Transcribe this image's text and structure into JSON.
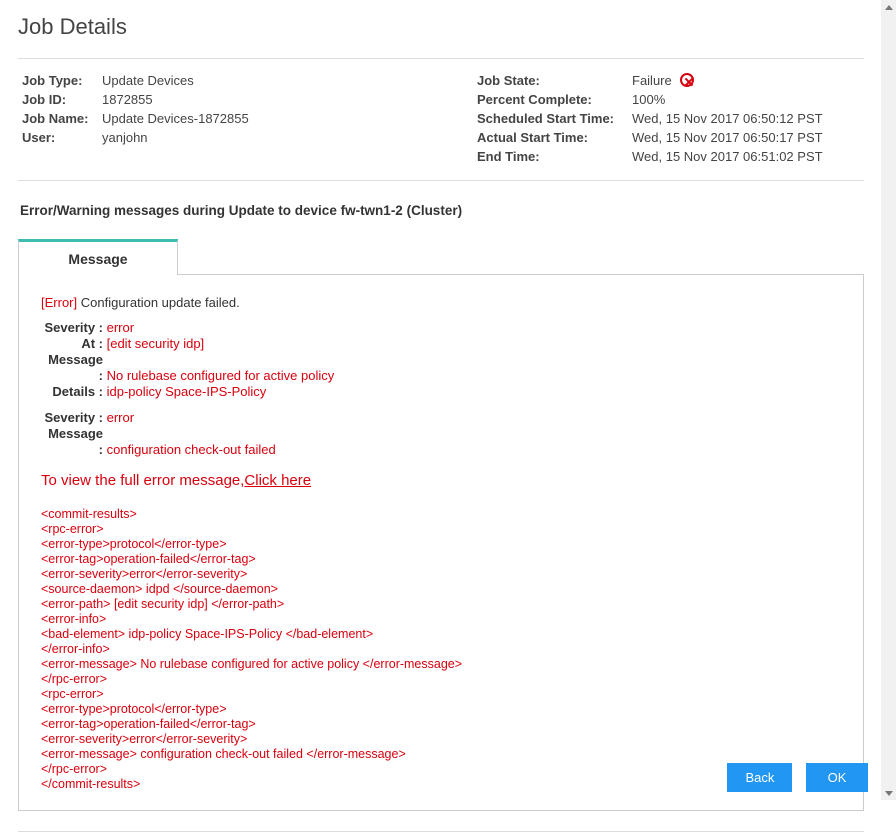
{
  "title": "Job Details",
  "left": {
    "job_type_label": "Job Type:",
    "job_type": "Update Devices",
    "job_id_label": "Job ID:",
    "job_id": "1872855",
    "job_name_label": "Job Name:",
    "job_name": "Update Devices-1872855",
    "user_label": "User:",
    "user": "yanjohn"
  },
  "right": {
    "job_state_label": "Job State:",
    "job_state": "Failure",
    "percent_label": "Percent Complete:",
    "percent": "100%",
    "scheduled_label": "Scheduled Start Time:",
    "scheduled": "Wed, 15 Nov 2017 06:50:12 PST",
    "actual_label": "Actual Start Time:",
    "actual": "Wed, 15 Nov 2017 06:50:17 PST",
    "end_label": "End Time:",
    "end": "Wed, 15 Nov 2017 06:51:02 PST"
  },
  "section_heading": "Error/Warning messages during Update to device fw-twn1-2 (Cluster)",
  "tab_label": "Message",
  "error": {
    "tag": "[Error]",
    "summary": " Configuration update failed.",
    "block1": {
      "severity_label": "Severity :",
      "severity": " error",
      "at_label": "At :",
      "at": " [edit security idp]",
      "message_label": "Message :",
      "message": " No rulebase configured for active policy",
      "details_label": "Details :",
      "details": " idp-policy Space-IPS-Policy"
    },
    "block2": {
      "severity_label": "Severity :",
      "severity": " error",
      "message_label": "Message :",
      "message": " configuration check-out failed"
    },
    "full_prefix": "To view the full error message,",
    "full_link": "Click here",
    "xml": "<commit-results>\n<rpc-error>\n<error-type>protocol</error-type>\n<error-tag>operation-failed</error-tag>\n<error-severity>error</error-severity>\n<source-daemon> idpd </source-daemon>\n<error-path> [edit security idp] </error-path>\n<error-info>\n<bad-element> idp-policy Space-IPS-Policy </bad-element>\n</error-info>\n<error-message> No rulebase configured for active policy </error-message>\n</rpc-error>\n<rpc-error>\n<error-type>protocol</error-type>\n<error-tag>operation-failed</error-tag>\n<error-severity>error</error-severity>\n<error-message> configuration check-out failed </error-message>\n</rpc-error>\n</commit-results>"
  },
  "buttons": {
    "back": "Back",
    "ok": "OK"
  }
}
